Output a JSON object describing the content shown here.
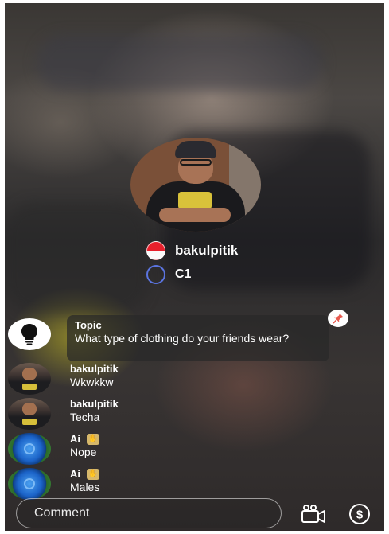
{
  "host": {
    "name": "bakulpitik",
    "level": "C1",
    "flag_icon": "indonesia-flag-icon"
  },
  "pinned_topic": {
    "title": "Topic",
    "text": "What type of clothing do your friends wear?"
  },
  "messages": [
    {
      "name": "bakulpitik",
      "text": "Wkwkkw"
    },
    {
      "name": "bakulpitik",
      "text": "Techa"
    },
    {
      "name": "Ai",
      "text": "Nope"
    },
    {
      "name": "Ai",
      "text": "Males"
    }
  ],
  "bottom_bar": {
    "comment_placeholder": "Comment"
  },
  "colors": {
    "level_ring": "#5b74e0",
    "pin": "#e85a4f",
    "badge": "#d7b86a"
  }
}
